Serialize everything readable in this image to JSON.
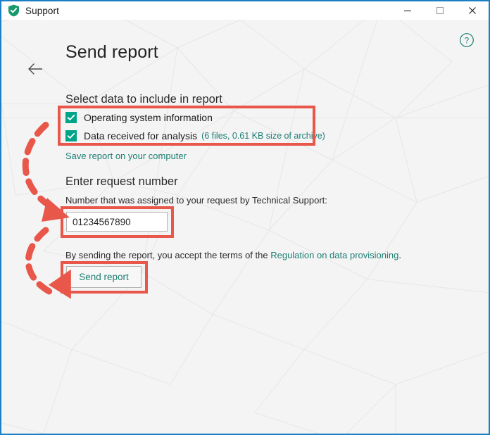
{
  "window": {
    "app_icon": "shield-check-icon",
    "title": "Support",
    "minimize_label": "Minimize",
    "maximize_label": "Maximize",
    "close_label": "Close",
    "border_color": "#1b7fc4"
  },
  "header": {
    "back_label": "Back",
    "page_title": "Send report",
    "help_label": "Help"
  },
  "select_data": {
    "heading": "Select data to include in report",
    "items": [
      {
        "label": "Operating system information",
        "note": "",
        "checked": true
      },
      {
        "label": "Data received for analysis",
        "note": "(6 files, 0.61 KB size of archive)",
        "checked": true
      }
    ],
    "save_link": "Save report on your computer"
  },
  "request": {
    "heading": "Enter request number",
    "subtitle": "Number that was assigned to your request by Technical Support:",
    "input_value": "01234567890",
    "input_placeholder": ""
  },
  "terms": {
    "prefix": "By sending the report, you accept the terms of the ",
    "link": "Regulation on data provisioning",
    "suffix": "."
  },
  "actions": {
    "send_label": "Send report"
  },
  "colors": {
    "accent_teal": "#1d7f74",
    "checkbox_green": "#00a489",
    "annotation_red": "#e8574a",
    "window_blue": "#1b7fc4"
  }
}
